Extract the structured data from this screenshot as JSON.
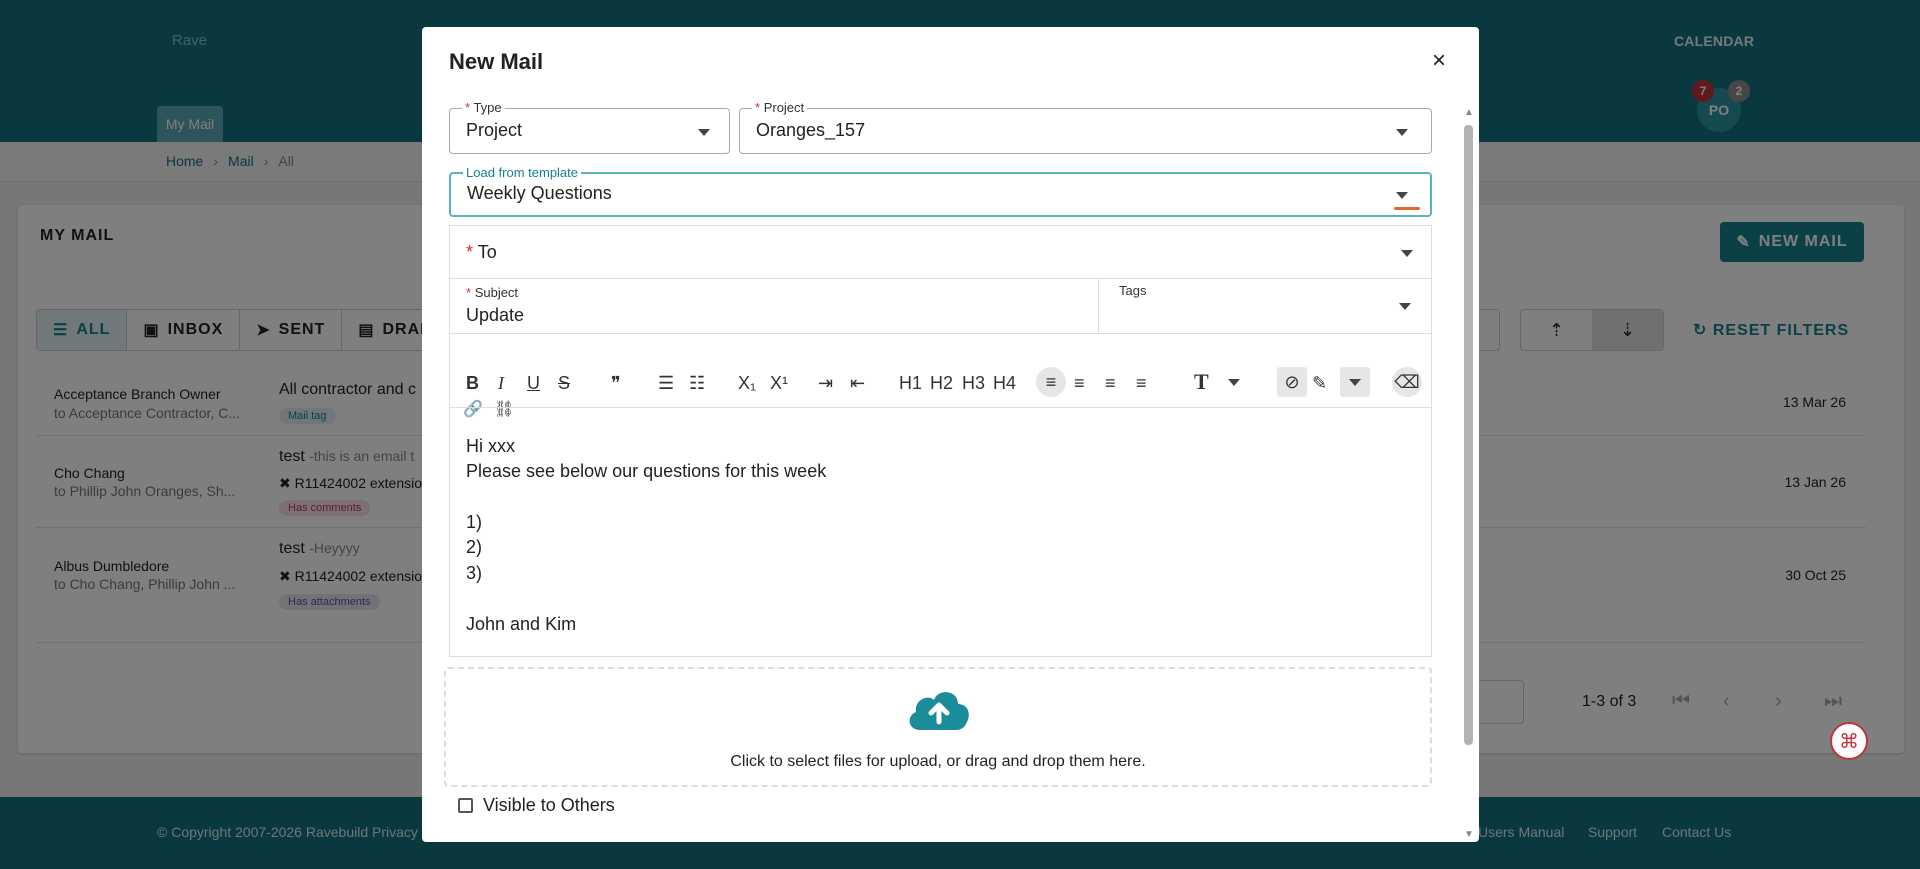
{
  "header": {
    "brand": "Rave",
    "calendar": "CALENDAR",
    "avatar": "PO",
    "badge_red": "7",
    "badge_grey": "2",
    "tab": "My Mail"
  },
  "breadcrumb": {
    "home": "Home",
    "mail": "Mail",
    "all": "All"
  },
  "page": {
    "title": "MY MAIL",
    "new_mail": "NEW MAIL",
    "reset_filters": "RESET FILTERS"
  },
  "filters": [
    {
      "label": "ALL"
    },
    {
      "label": "INBOX"
    },
    {
      "label": "SENT"
    },
    {
      "label": "DRAF"
    }
  ],
  "rows": [
    {
      "name": "Acceptance Branch Owner",
      "to": "to Acceptance Contractor, C...",
      "subject": "All contractor and c",
      "snippet": "",
      "line": "",
      "chips": [
        "Mail tag"
      ],
      "date": "13 Mar 26"
    },
    {
      "name": "Cho Chang",
      "to": "to Phillip John Oranges, Sh...",
      "subject": "test",
      "snippet": "-this is an email t",
      "line": "R11424002 extensio",
      "chips": [
        "Has comments"
      ],
      "date": "13 Jan 26"
    },
    {
      "name": "Albus Dumbledore",
      "to": "to Cho Chang, Phillip John ...",
      "subject": "test",
      "snippet": "-Heyyyy",
      "line": "R11424002 extensio",
      "chips": [
        "Has attachments"
      ],
      "date": "30 Oct 25"
    }
  ],
  "pagination": {
    "range": "1-3 of 3"
  },
  "footer": {
    "copyright": "© Copyright 2007-2026 Ravebuild",
    "privacy": "Privacy I",
    "manual": "Users Manual",
    "support": "Support",
    "contact": "Contact Us"
  },
  "modal": {
    "title": "New Mail",
    "close": "×",
    "type": {
      "label": "Type",
      "value": "Project"
    },
    "project": {
      "label": "Project",
      "value": "Oranges_157"
    },
    "template": {
      "label": "Load from template",
      "value": "Weekly Questions"
    },
    "to": {
      "label": "To"
    },
    "subject": {
      "label": "Subject",
      "value": "Update"
    },
    "tags": {
      "label": "Tags"
    },
    "toolbar": {
      "bold": "B",
      "italic": "I",
      "underline": "U",
      "strike": "S",
      "quote": "❞",
      "ol": "☰",
      "ul": "☷",
      "sub": "X₁",
      "sup": "X¹",
      "indent": "⇥",
      "outdent": "⇤",
      "h1": "H1",
      "h2": "H2",
      "h3": "H3",
      "h4": "H4",
      "left": "≡",
      "center": "≡",
      "right": "≡",
      "justify": "≡",
      "textstyle": "T",
      "link": "🔗",
      "unlink": "⛓"
    },
    "body": [
      "Hi xxx",
      "Please see below our questions for this week",
      "",
      "1)",
      "2)",
      "3)",
      "",
      "John and Kim"
    ],
    "upload": "Click to select files for upload, or drag and drop them here.",
    "visible": "Visible to Others"
  },
  "colors": {
    "teal": "#14707e",
    "accent": "#17818f",
    "required": "#e02828",
    "template_underline": "#e06a2a"
  }
}
